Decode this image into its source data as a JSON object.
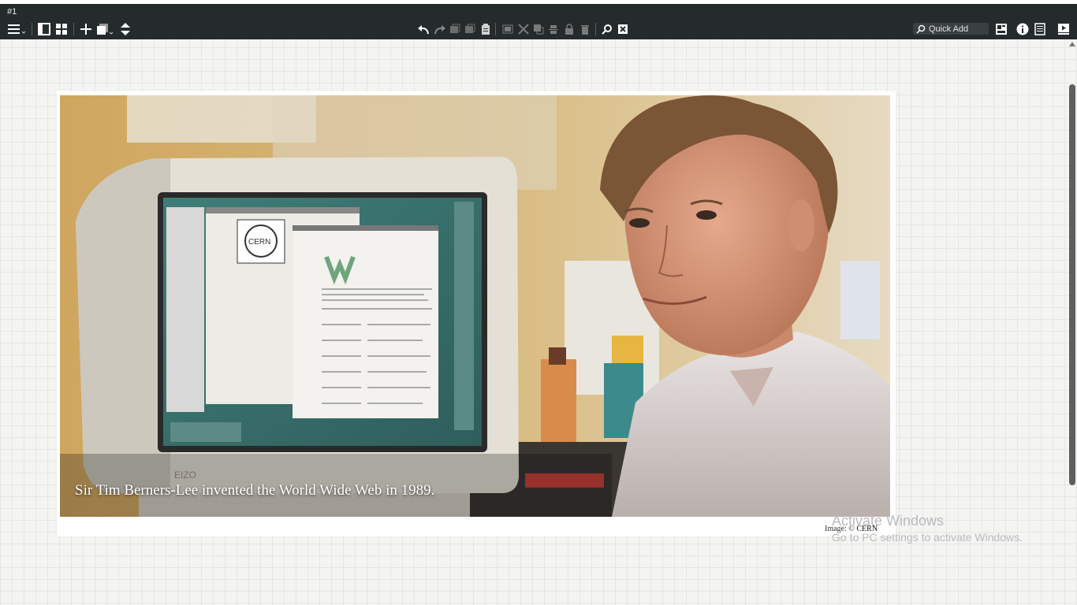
{
  "tab": {
    "label": "#1"
  },
  "toolbar": {
    "quick_add_label": "Quick Add",
    "accent": "#252a2b"
  },
  "article": {
    "caption": "Sir Tim Berners-Lee invented the World Wide Web in 1989.",
    "credit_prefix": "Image: ©",
    "credit_source": "CERN"
  },
  "photo": {
    "monitor_logo": "CERN",
    "monitor_brand": "EIZO"
  },
  "watermark": {
    "title": "Activate Windows",
    "subtitle": "Go to PC settings to activate Windows."
  }
}
